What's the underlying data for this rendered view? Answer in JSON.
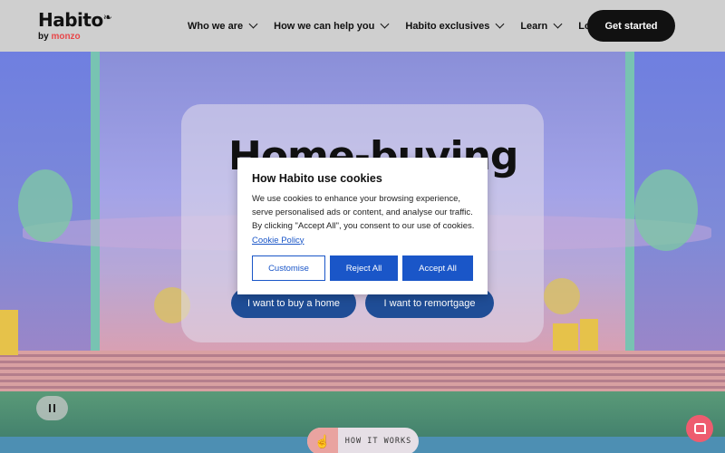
{
  "header": {
    "logo_text": "Habito",
    "logo_by": "by",
    "logo_brand": "monzo",
    "nav": [
      {
        "label": "Who we are"
      },
      {
        "label": "How we can help you"
      },
      {
        "label": "Habito exclusives"
      },
      {
        "label": "Learn"
      }
    ],
    "login_label": "Log in",
    "cta_label": "Get started"
  },
  "hero": {
    "title": "Home-buying",
    "buy_button": "I want to buy a home",
    "remortgage_button": "I want to remortgage"
  },
  "cookie_dialog": {
    "title": "How Habito use cookies",
    "text": "We use cookies to enhance your browsing experience, serve personalised ads or content, and analyse our traffic. By clicking \"Accept All\", you consent to our use of cookies.",
    "policy_link": "Cookie Policy",
    "customise_label": "Customise",
    "reject_label": "Reject All",
    "accept_label": "Accept All"
  },
  "bottom": {
    "how_it_works_label": "HOW IT WORKS",
    "how_icon": "hand-pointer-icon",
    "pause_icon": "pause-icon",
    "chat_icon": "chat-icon"
  },
  "colors": {
    "primary_blue": "#1a56c8",
    "hero_button": "#1f4d96",
    "header_bg": "#cfcfcf",
    "brand_accent": "#e8474a",
    "chat": "#ee5c6f"
  }
}
